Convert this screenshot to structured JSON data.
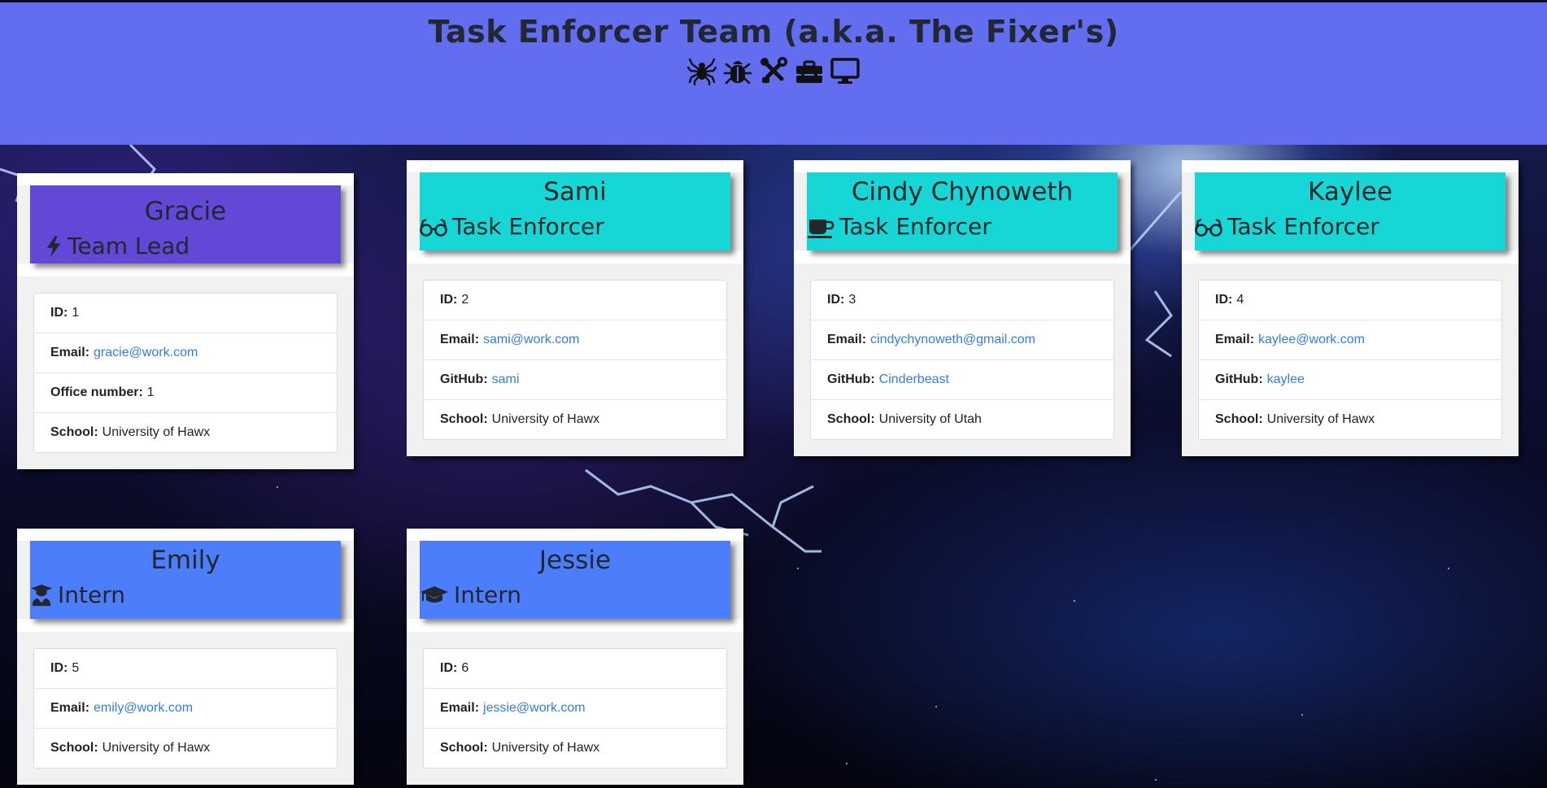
{
  "header": {
    "title": "Task Enforcer Team (a.k.a. The Fixer's)",
    "icons": [
      "spider-icon",
      "bug-icon",
      "tools-icon",
      "toolbox-icon",
      "desktop-icon"
    ],
    "background_color": "#636df0"
  },
  "labels": {
    "id": "ID:",
    "email": "Email:",
    "github": "GitHub:",
    "office": "Office number:",
    "school": "School:"
  },
  "colors": {
    "manager": "#6347d6",
    "engineer": "#16d7d6",
    "intern": "#4c7efb",
    "link": "#2f7ee0"
  },
  "team": [
    {
      "name": "Gracie",
      "role": "Team Lead",
      "role_icon": "bolt-icon",
      "id": "1",
      "email": "gracie@work.com",
      "office_number": "1",
      "school": "University of Hawx"
    },
    {
      "name": "Sami",
      "role": "Task Enforcer",
      "role_icon": "glasses-icon",
      "id": "2",
      "email": "sami@work.com",
      "github": "sami",
      "school": "University of Hawx"
    },
    {
      "name": "Cindy Chynoweth",
      "role": "Task Enforcer",
      "role_icon": "coffee-icon",
      "id": "3",
      "email": "cindychynoweth@gmail.com",
      "github": "Cinderbeast",
      "school": "University of Utah"
    },
    {
      "name": "Kaylee",
      "role": "Task Enforcer",
      "role_icon": "glasses-icon",
      "id": "4",
      "email": "kaylee@work.com",
      "github": "kaylee",
      "school": "University of Hawx"
    },
    {
      "name": "Emily",
      "role": "Intern",
      "role_icon": "graduate-icon",
      "id": "5",
      "email": "emily@work.com",
      "school": "University of Hawx"
    },
    {
      "name": "Jessie",
      "role": "Intern",
      "role_icon": "graduation-cap-icon",
      "id": "6",
      "email": "jessie@work.com",
      "school": "University of Hawx"
    }
  ]
}
